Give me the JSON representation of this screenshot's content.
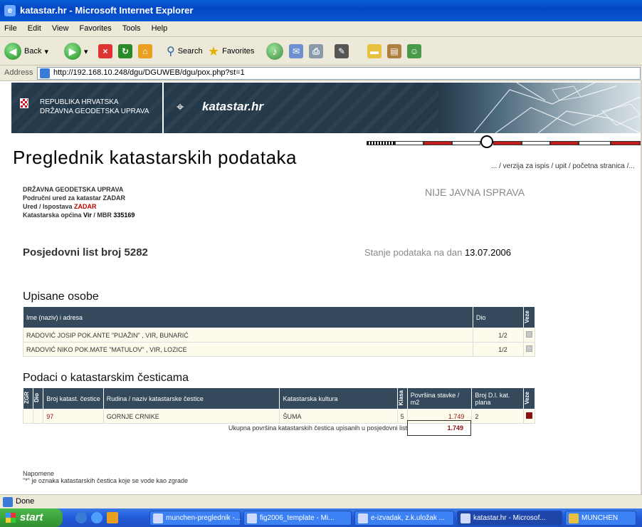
{
  "window": {
    "title": "katastar.hr - Microsoft Internet Explorer"
  },
  "menu": [
    "File",
    "Edit",
    "View",
    "Favorites",
    "Tools",
    "Help"
  ],
  "toolbar": {
    "back_label": "Back",
    "search_label": "Search",
    "favorites_label": "Favorites"
  },
  "address": {
    "label": "Address",
    "url": "http://192.168.10.248/dgu/DGUWEB/dgu/pox.php?st=1"
  },
  "banner": {
    "org_line1": "REPUBLIKA HRVATSKA",
    "org_line2": "DRŽAVNA GEODETSKA UPRAVA",
    "logo": "katastar.hr"
  },
  "page": {
    "title": "Preglednik katastarskih podataka",
    "links": "... / verzija za ispis / upit / početna stranica /...",
    "office_line1": "DRŽAVNA GEODETSKA UPRAVA",
    "office_line2": "Područni ured za katastar ZADAR",
    "office_line3_label": "Ured / Ispostava ",
    "office_line3_value": "ZADAR",
    "office_line4_label": "Katastarska općina ",
    "office_line4_value": "Vir",
    "office_line4_mbr_label": " / MBR ",
    "office_line4_mbr": "335169",
    "not_public": "NIJE JAVNA ISPRAVA",
    "possession_sheet": "Posjedovni list broj 5282",
    "state_label": "Stanje podataka na dan ",
    "state_date": "13.07.2006"
  },
  "persons": {
    "title": "Upisane osobe",
    "headers": {
      "name": "Ime (naziv) i adresa",
      "share": "Dio",
      "links": "Veze"
    },
    "rows": [
      {
        "name": "RADOVIĆ JOSIP POK.ANTE \"PIJAŽIN\" , VIR, BUNARIĆ",
        "share": "1/2"
      },
      {
        "name": "RADOVIĆ NIKO POK.MATE \"MATULOV\" , VIR, LOZICE",
        "share": "1/2"
      }
    ]
  },
  "parcels": {
    "title": "Podaci o katastarskim česticama",
    "headers": {
      "zgr": "ZGR",
      "dio": "Dio",
      "number": "Broj katast. čestice",
      "name": "Rudina / naziv katastarske čestice",
      "culture": "Katastarska kultura",
      "class": "Klasa",
      "area": "Površina stavke / m2",
      "plan": "Broj D.l. kat. plana",
      "links": "Veze"
    },
    "rows": [
      {
        "zgr": "",
        "dio": "",
        "number": "97",
        "name": "GORNJE CRNIKE",
        "culture": "ŠUMA",
        "class": "5",
        "area": "1.749",
        "plan": "2"
      }
    ],
    "total_label": "Ukupna površina katastarskih čestica upisanih u posjedovni list",
    "total_value": "1.749"
  },
  "notes": {
    "title": "Napomene",
    "line1": "\"*\" je oznaka katastarskih čestica koje se vode kao zgrade"
  },
  "status": {
    "text": "Done"
  },
  "taskbar": {
    "start": "start",
    "tasks": [
      {
        "label": "munchen-preglednik -..."
      },
      {
        "label": "fig2006_template - Mi..."
      },
      {
        "label": "e-izvadak, z.k.uložak ..."
      },
      {
        "label": "katastar.hr - Microsof..."
      },
      {
        "label": "MUNCHEN"
      }
    ]
  },
  "colors": {
    "header_bg": "#34495b",
    "accent_red": "#8b1010",
    "xp_blue": "#245edb"
  }
}
